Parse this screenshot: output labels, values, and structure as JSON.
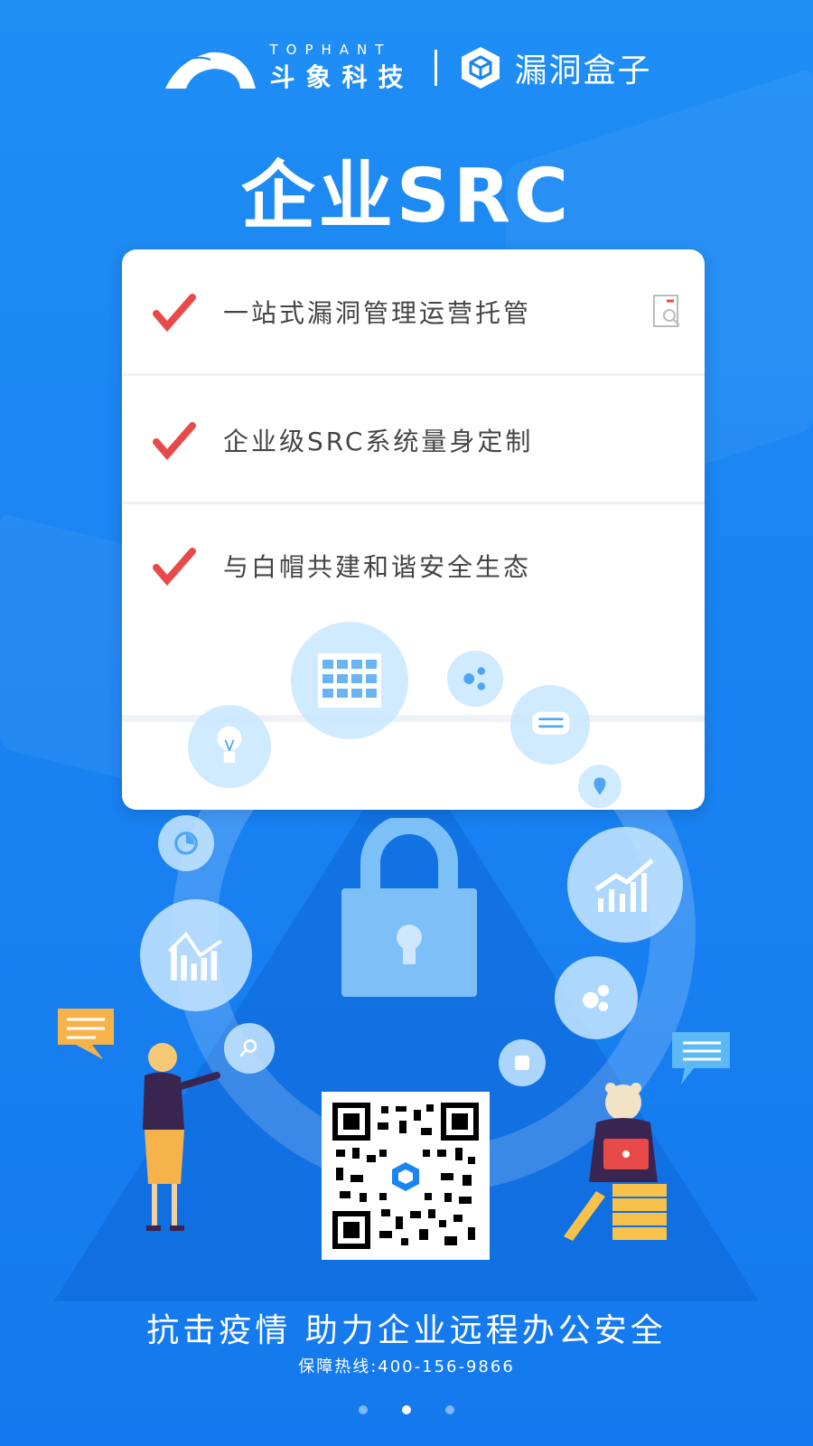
{
  "header": {
    "brand_en": "TOPHANT",
    "brand_cn": "斗象科技",
    "product_name": "漏洞盒子"
  },
  "title": "企业SRC",
  "features": [
    {
      "label": "一站式漏洞管理运营托管"
    },
    {
      "label": "企业级SRC系统量身定制"
    },
    {
      "label": "与白帽共建和谐安全生态"
    }
  ],
  "footer": {
    "slogan": "抗击疫情  助力企业远程办公安全",
    "hotline": "保障热线:400-156-9866"
  },
  "pager": {
    "total": 3,
    "active_index": 1
  },
  "colors": {
    "background": "#1a84f3",
    "check": "#e84a4a",
    "card_text": "#444444"
  },
  "icons": [
    "check-icon",
    "document-search-icon",
    "calendar-icon",
    "share-icon",
    "chat-icon",
    "location-icon",
    "growth-chart-icon",
    "gears-icon",
    "puzzle-icon",
    "search-icon",
    "bar-chart-icon",
    "timer-icon",
    "lightbulb-icon",
    "lock-icon",
    "qr-code"
  ]
}
